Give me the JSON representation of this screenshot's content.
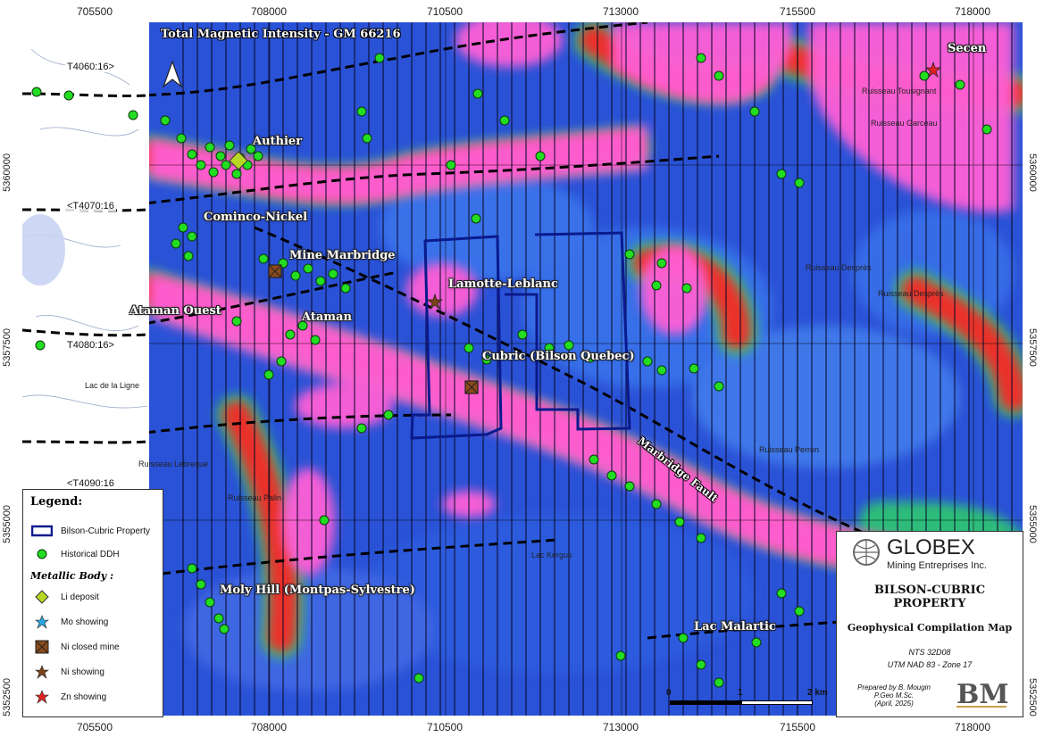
{
  "map_title": "Total Magnetic Intensity - GM 66216",
  "coordinates": {
    "eastings": [
      "705500",
      "708000",
      "710500",
      "713000",
      "715500",
      "718000"
    ],
    "northings": [
      "5360000",
      "5357500",
      "5355000",
      "5352500"
    ]
  },
  "line_labels": [
    "T4060:16>",
    "<T4070:16",
    "T4080:16>",
    "<T4090:16"
  ],
  "places": {
    "authier": "Authier",
    "cominco": "Cominco-Nickel",
    "mine_marbridge": "Mine Marbridge",
    "ataman_ouest": "Ataman Ouest",
    "ataman": "Ataman",
    "lamotte": "Lamotte-Leblanc",
    "cubric": "Cubric (Bilson Quebec)",
    "moly_hill": "Moly Hill (Montpas-Sylvestre)",
    "lac_malartic": "Lac Malartic",
    "secen": "Secen"
  },
  "fault_label": "Marbridge Fault",
  "legend": {
    "title": "Legend:",
    "property": "Bilson-Cubric Property",
    "ddh": "Historical DDH",
    "metallic_title": "Metallic Body :",
    "items": [
      "Li deposit",
      "Mo showing",
      "Ni closed mine",
      "Ni showing",
      "Zn showing"
    ]
  },
  "title_block": {
    "company": "GLOBEX",
    "company_sub": "Mining Entreprises Inc.",
    "property_line1": "BILSON-CUBRIC",
    "property_line2": "PROPERTY",
    "map_name": "Geophysical Compilation Map",
    "nts": "NTS 32D08",
    "utm": "UTM NAD 83 - Zone 17",
    "prepared_by": "Prepared by B. Mougin",
    "credentials": "P.Geo M.Sc.",
    "date": "(April, 2025)",
    "scale_labels": [
      "0",
      "1",
      "2 km"
    ],
    "logo_text": "BM"
  },
  "colors": {
    "low_magnetic": "#1f4fd8",
    "high_magnetic": "#ff66d9",
    "mid_red": "#ff1a1a",
    "property_outline": "#0a1a8c",
    "ddh_green": "#22dd22"
  }
}
